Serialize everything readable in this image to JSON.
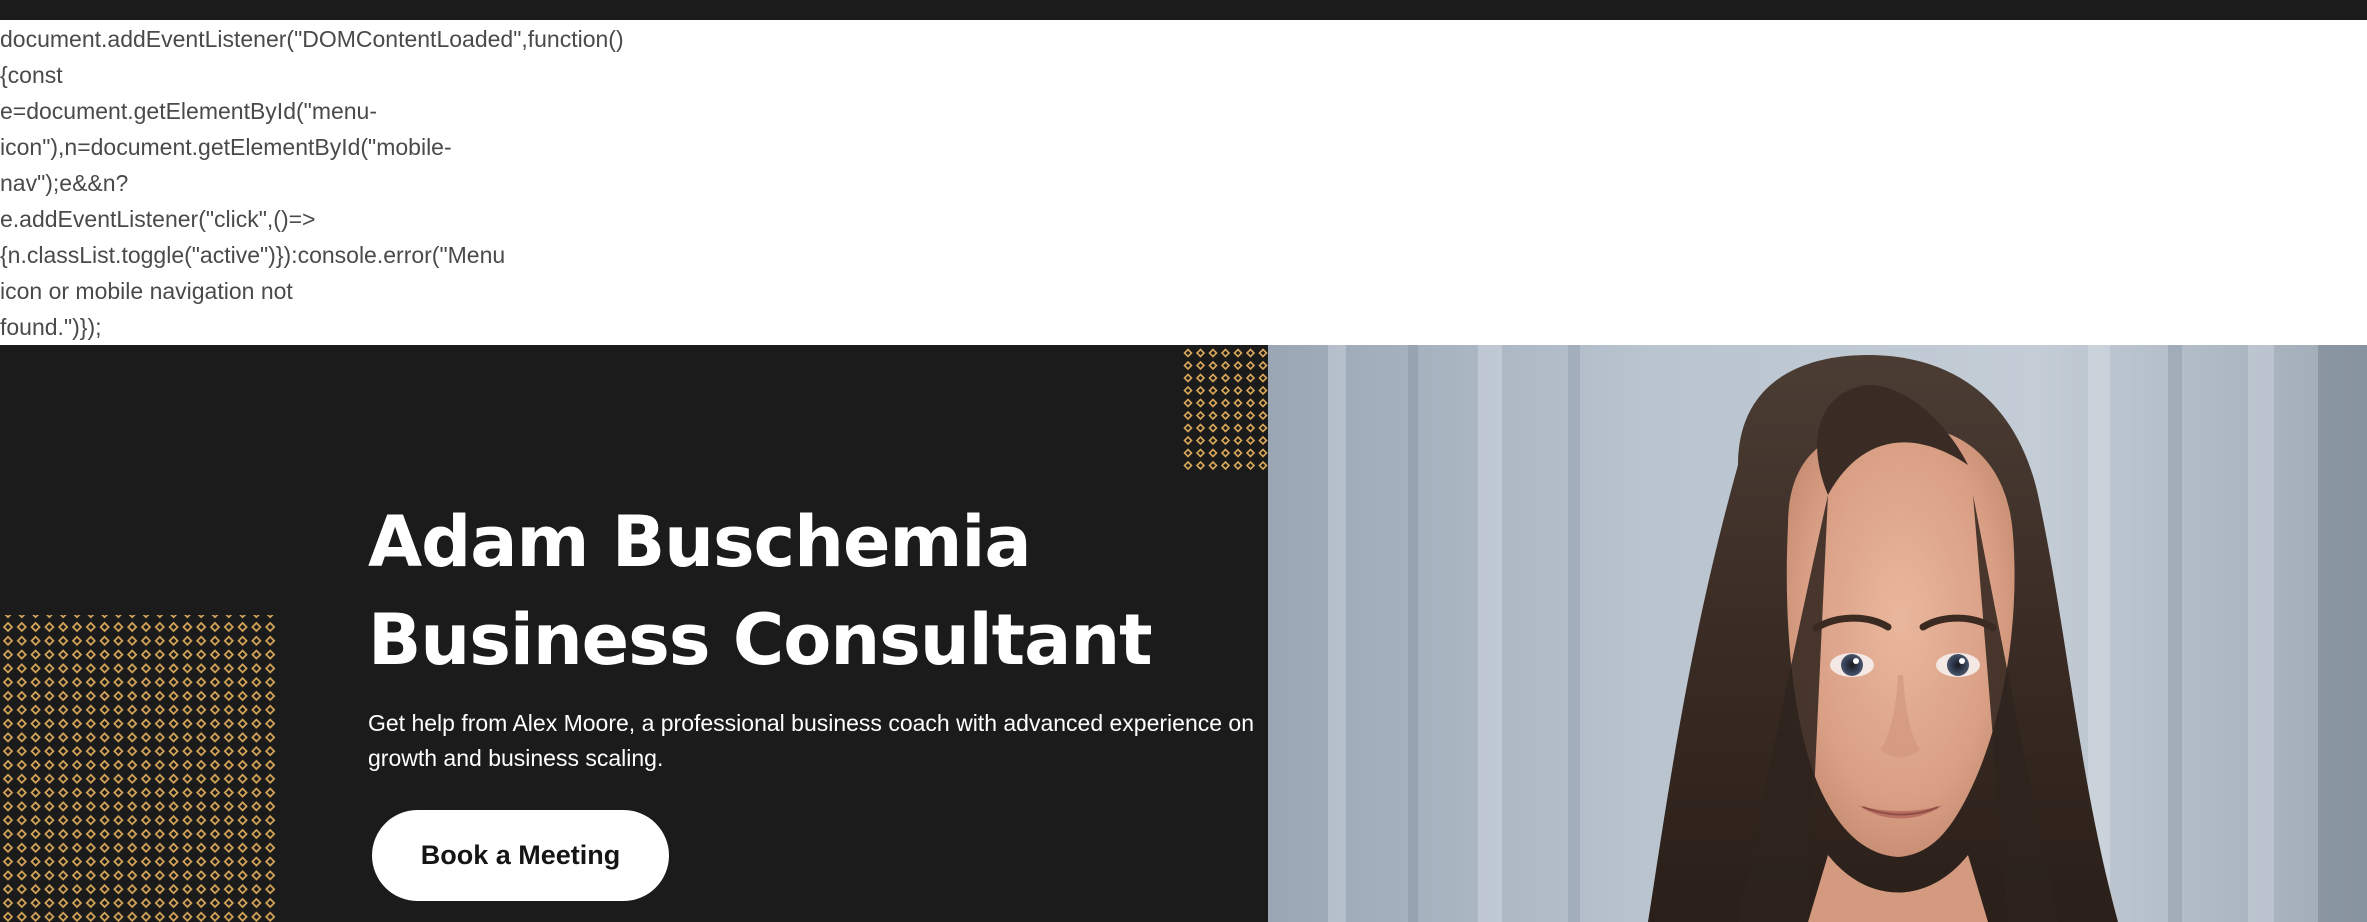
{
  "code_leak": {
    "lines": [
      "document.addEventListener(\"DOMContentLoaded\",function()",
      "{const",
      "e=document.getElementById(\"menu-",
      "icon\"),n=document.getElementById(\"mobile-",
      "nav\");e&&n?",
      "e.addEventListener(\"click\",()=>",
      "{n.classList.toggle(\"active\")}):console.error(\"Menu",
      "icon or mobile navigation not",
      "found.\")});"
    ]
  },
  "hero": {
    "title_line1": "Adam Buschemia",
    "title_line2": "Business Consultant",
    "subtitle": "Get help from Alex Moore, a professional business coach with advanced experience on growth and business scaling.",
    "cta_label": "Book a Meeting"
  },
  "colors": {
    "hero_background": "#1b1b1b",
    "accent_gold": "#d9a85a",
    "button_background": "#ffffff"
  }
}
